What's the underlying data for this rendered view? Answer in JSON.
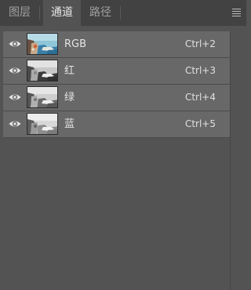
{
  "tabs": [
    {
      "label": "图层",
      "active": false
    },
    {
      "label": "通道",
      "active": true
    },
    {
      "label": "路径",
      "active": false
    }
  ],
  "menu_icon": "hamburger-menu-icon",
  "channels": [
    {
      "name": "RGB",
      "shortcut": "Ctrl+2",
      "visible": true,
      "thumb": "color"
    },
    {
      "name": "红",
      "shortcut": "Ctrl+3",
      "visible": true,
      "thumb": "gray"
    },
    {
      "name": "绿",
      "shortcut": "Ctrl+4",
      "visible": true,
      "thumb": "gray"
    },
    {
      "name": "蓝",
      "shortcut": "Ctrl+5",
      "visible": true,
      "thumb": "gray"
    }
  ],
  "colors": {
    "panel_bg": "#535353",
    "tabbar_bg": "#424242",
    "row_bg": "#686868"
  }
}
